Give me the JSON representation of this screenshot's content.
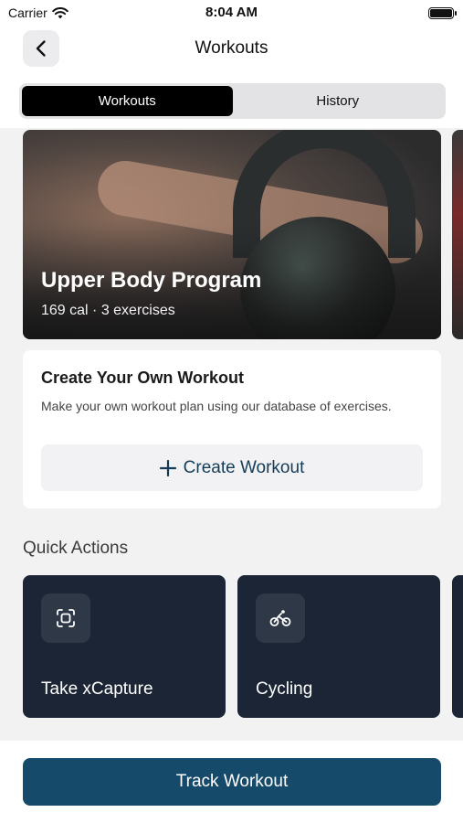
{
  "status_bar": {
    "carrier": "Carrier",
    "time": "8:04 AM",
    "battery_level": 1.0
  },
  "nav": {
    "title": "Workouts",
    "back_icon": "chevron-left-icon"
  },
  "segments": {
    "tabs": [
      {
        "label": "Workouts",
        "active": true
      },
      {
        "label": "History",
        "active": false
      }
    ]
  },
  "featured": {
    "title": "Upper Body Program",
    "subtitle": "169 cal · 3 exercises"
  },
  "create": {
    "title": "Create Your Own Workout",
    "description": "Make your own workout plan using our database of exercises.",
    "button_label": "Create Workout",
    "button_icon": "plus-icon"
  },
  "quick_actions": {
    "title": "Quick Actions",
    "items": [
      {
        "label": "Take xCapture",
        "icon": "scan-icon"
      },
      {
        "label": "Cycling",
        "icon": "bicycle-icon"
      }
    ]
  },
  "bottom": {
    "track_label": "Track Workout"
  },
  "colors": {
    "accent": "#164a6b",
    "card_dark": "#1b2535",
    "create_text": "#143c58",
    "segment_active": "#000000"
  }
}
